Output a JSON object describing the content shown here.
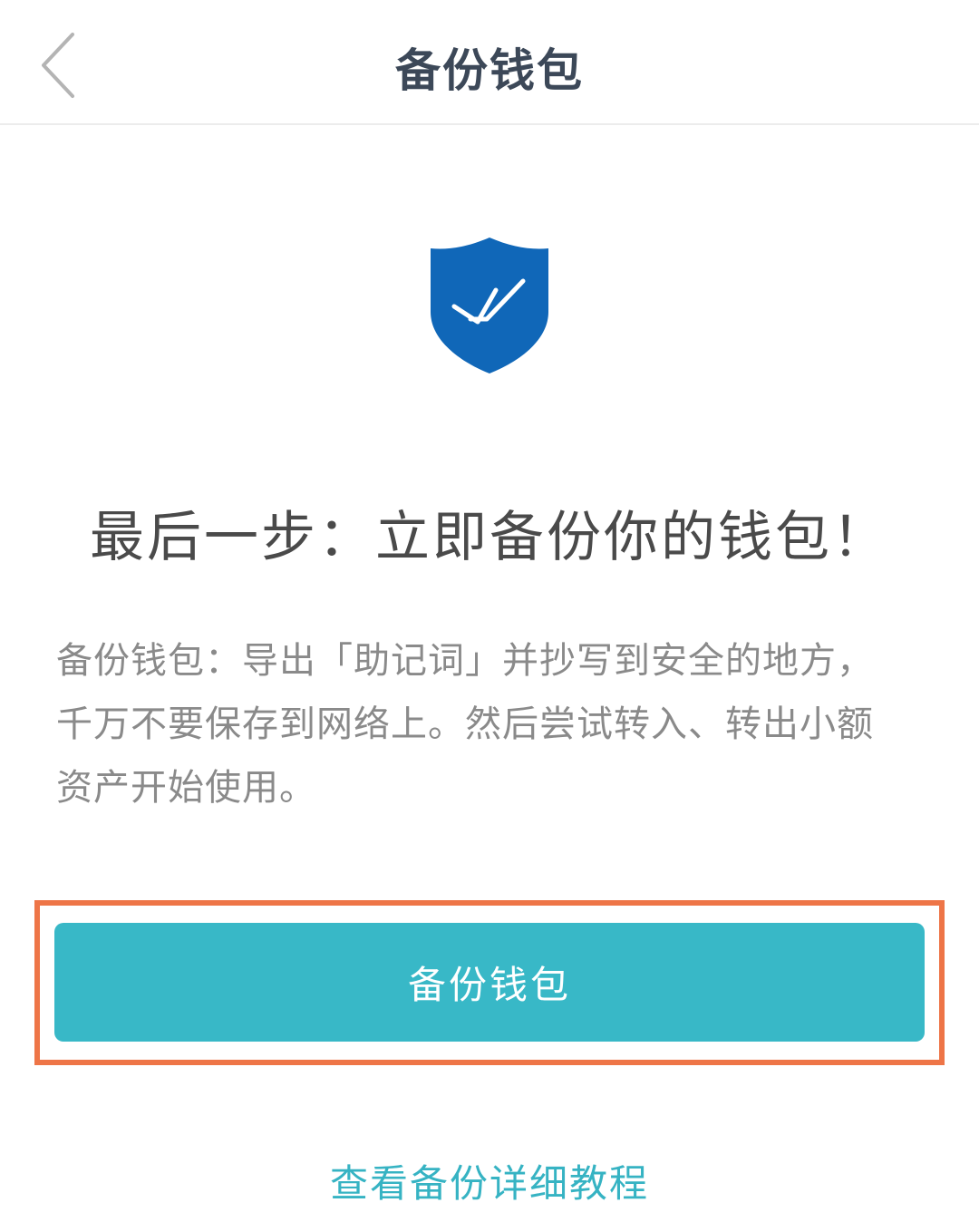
{
  "header": {
    "title": "备份钱包",
    "back_icon": "chevron-left-icon"
  },
  "hero": {
    "icon": "shield-check-icon",
    "icon_color": "#1067b8"
  },
  "headline": "最后一步：立即备份你的钱包！",
  "description": "备份钱包：导出「助记词」并抄写到安全的地方，千万不要保存到网络上。然后尝试转入、转出小额资产开始使用。",
  "actions": {
    "backup_button_label": "备份钱包",
    "tutorial_link_label": "查看备份详细教程"
  },
  "colors": {
    "accent": "#38b8c7",
    "highlight": "#ee7547",
    "title_text": "#3c4858",
    "body_text": "#8a8a8a"
  }
}
